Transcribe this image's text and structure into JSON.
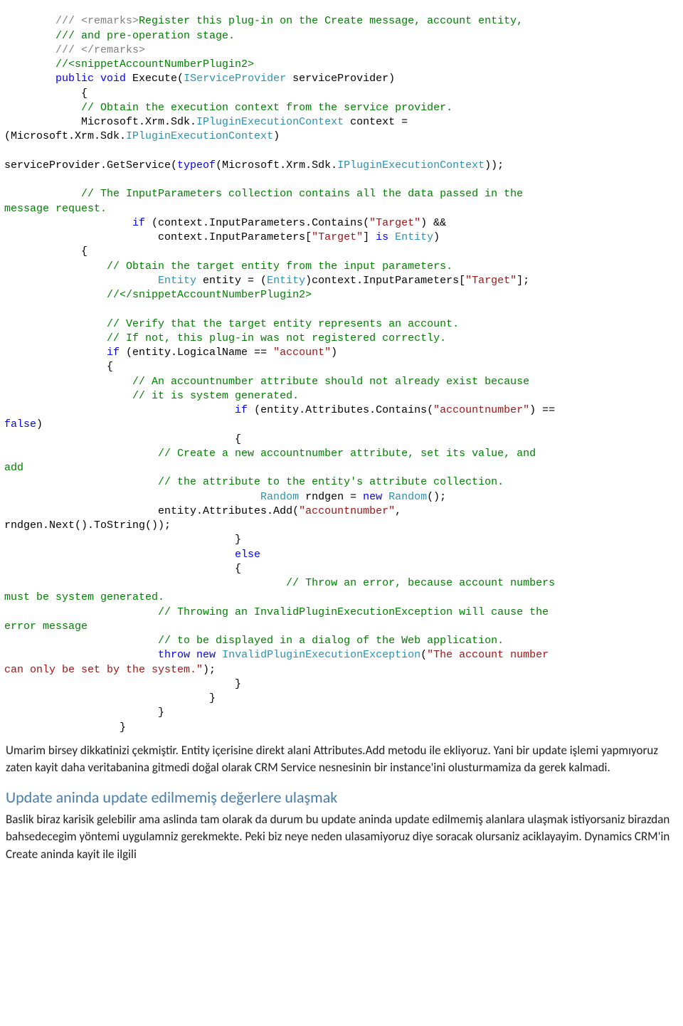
{
  "code": {
    "l01a": "        /// <remarks>",
    "l01b": "Register this plug-in on the Create message, account entity,",
    "l02": "        /// and pre-operation stage.",
    "l03": "        /// </remarks>",
    "l04": "        //<snippetAccountNumberPlugin2>",
    "l05a": "        public",
    "l05b": " void",
    "l05c": " Execute(",
    "l05d": "IServiceProvider",
    "l05e": " serviceProvider)",
    "l06": "            {",
    "l07": "            // Obtain the execution context from the service provider.",
    "l08a": "            Microsoft.Xrm.Sdk.",
    "l08b": "IPluginExecutionContext",
    "l08c": " context = ",
    "l08d": "(Microsoft.Xrm.Sdk.",
    "l08e": "IPluginExecutionContext",
    "l08f": ")",
    "l09a": "serviceProvider.GetService(",
    "l09b": "typeof",
    "l09c": "(Microsoft.Xrm.Sdk.",
    "l09d": "IPluginExecutionContext",
    "l09e": "));",
    "l10": "            // The InputParameters collection contains all the data passed in the ",
    "l10b": "message request.",
    "l11a": "                    if",
    "l11b": " (context.InputParameters.Contains(",
    "l11c": "\"Target\"",
    "l11d": ") &&",
    "l12a": "                        context.InputParameters[",
    "l12b": "\"Target\"",
    "l12c": "] ",
    "l12d": "is",
    "l12e": " Entity",
    "l12f": ")",
    "l13": "            {",
    "l14": "                // Obtain the target entity from the input parameters.",
    "l15a": "                        Entity",
    "l15b": " entity = (",
    "l15c": "Entity",
    "l15d": ")context.InputParameters[",
    "l15e": "\"Target\"",
    "l15f": "];",
    "l16": "                //</snippetAccountNumberPlugin2>",
    "l17": "                // Verify that the target entity represents an account.",
    "l18": "                // If not, this plug-in was not registered correctly.",
    "l19a": "                if",
    "l19b": " (entity.LogicalName == ",
    "l19c": "\"account\"",
    "l19d": ")",
    "l20": "                {",
    "l21": "                    // An accountnumber attribute should not already exist because",
    "l22": "                    // it is system generated.",
    "l23a": "                                    if",
    "l23b": " (entity.Attributes.Contains(",
    "l23c": "\"accountnumber\"",
    "l23d": ") == ",
    "l23e": "false",
    "l23f": ")",
    "l24": "                                    {",
    "l25": "                        // Create a new accountnumber attribute, set its value, and ",
    "l25b": "add",
    "l26": "                        // the attribute to the entity's attribute collection.",
    "l27a": "                                        Random",
    "l27b": " rndgen = ",
    "l27c": "new",
    "l27d": " Random",
    "l27e": "();",
    "l28a": "                        entity.Attributes.Add(",
    "l28b": "\"accountnumber\"",
    "l28c": ", ",
    "l28d": "rndgen.Next().ToString());",
    "l29": "                                    }",
    "l30": "                                    else",
    "l31": "                                    {",
    "l32": "                                            // Throw an error, because account numbers ",
    "l32b": "must be system generated.",
    "l33": "                        // Throwing an InvalidPluginExecutionException will cause the ",
    "l33b": "error message",
    "l34": "                        // to be displayed in a dialog of the Web application.",
    "l35a": "                        throw",
    "l35b": " new",
    "l35c": " InvalidPluginExecutionException",
    "l35d": "(",
    "l35e": "\"The account number ",
    "l35f": "can only be set by the system.\"",
    "l35g": ");",
    "l36": "                                    }",
    "l37": "                                }",
    "l38": "                        }",
    "l39": "                  }"
  },
  "prose": {
    "p1": "Umarim birsey dikkatinizi çekmiştir. Entity içerisine direkt alani Attributes.Add metodu ile ekliyoruz. Yani bir update işlemi yapmıyoruz zaten kayit daha veritabanina gitmedi doğal olarak CRM Service nesnesinin bir instance'ini olusturmamiza da gerek kalmadi.",
    "h1": "Update aninda update edilmemiş değerlere ulaşmak",
    "p2": "Baslik biraz karisik gelebilir ama aslinda tam olarak da durum bu update aninda update edilmemiş alanlara ulaşmak istiyorsaniz birazdan bahsedecegim yöntemi uygulamniz gerekmekte. Peki biz neye neden ulasamiyoruz diye soracak olursaniz aciklayayim. Dynamics CRM'in Create aninda kayit ile ilgili"
  }
}
